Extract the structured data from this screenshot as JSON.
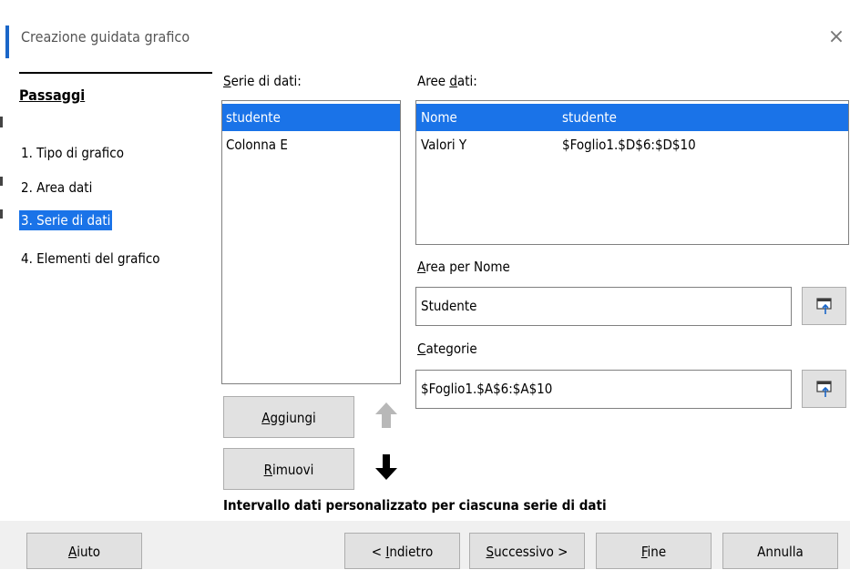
{
  "window": {
    "title": "Creazione guidata grafico",
    "close_glyph": "×"
  },
  "steps": {
    "heading": "Passaggi",
    "items": [
      {
        "label": "1. Tipo di grafico",
        "selected": false
      },
      {
        "label": "2. Area dati",
        "selected": false
      },
      {
        "label": "3. Serie di dati",
        "selected": true
      },
      {
        "label": "4. Elementi del grafico",
        "selected": false
      }
    ]
  },
  "series": {
    "label_prefix": "",
    "label_u": "S",
    "label_rest": "erie di dati:",
    "items": [
      {
        "label": "studente",
        "selected": true
      },
      {
        "label": "Colonna E",
        "selected": false
      }
    ],
    "add_u": "A",
    "add_rest": "ggiungi",
    "remove_u": "R",
    "remove_rest": "imuovi"
  },
  "ranges": {
    "label_pre": "Aree ",
    "label_u": "d",
    "label_rest": "ati:",
    "rows": [
      {
        "role": "Nome",
        "range": "studente",
        "selected": true
      },
      {
        "role": "Valori Y",
        "range": "$Foglio1.$D$6:$D$10",
        "selected": false
      }
    ]
  },
  "name_range": {
    "label_u": "A",
    "label_rest": "rea per Nome",
    "value": "Studente"
  },
  "categories": {
    "label_u": "C",
    "label_rest": "ategorie",
    "value": "$Foglio1.$A$6:$A$10"
  },
  "custom_note": "Intervallo dati personalizzato per ciascuna serie di dati",
  "footer": {
    "help_u": "A",
    "help_rest": "iuto",
    "back_pre": "< ",
    "back_u": "I",
    "back_rest": "ndietro",
    "next_u": "S",
    "next_rest": "uccessivo >",
    "finish_u": "F",
    "finish_rest": "ine",
    "cancel": "Annulla"
  },
  "colors": {
    "selection": "#1a73e8",
    "accent": "#1a66c8",
    "button_face": "#e1e1e1"
  }
}
